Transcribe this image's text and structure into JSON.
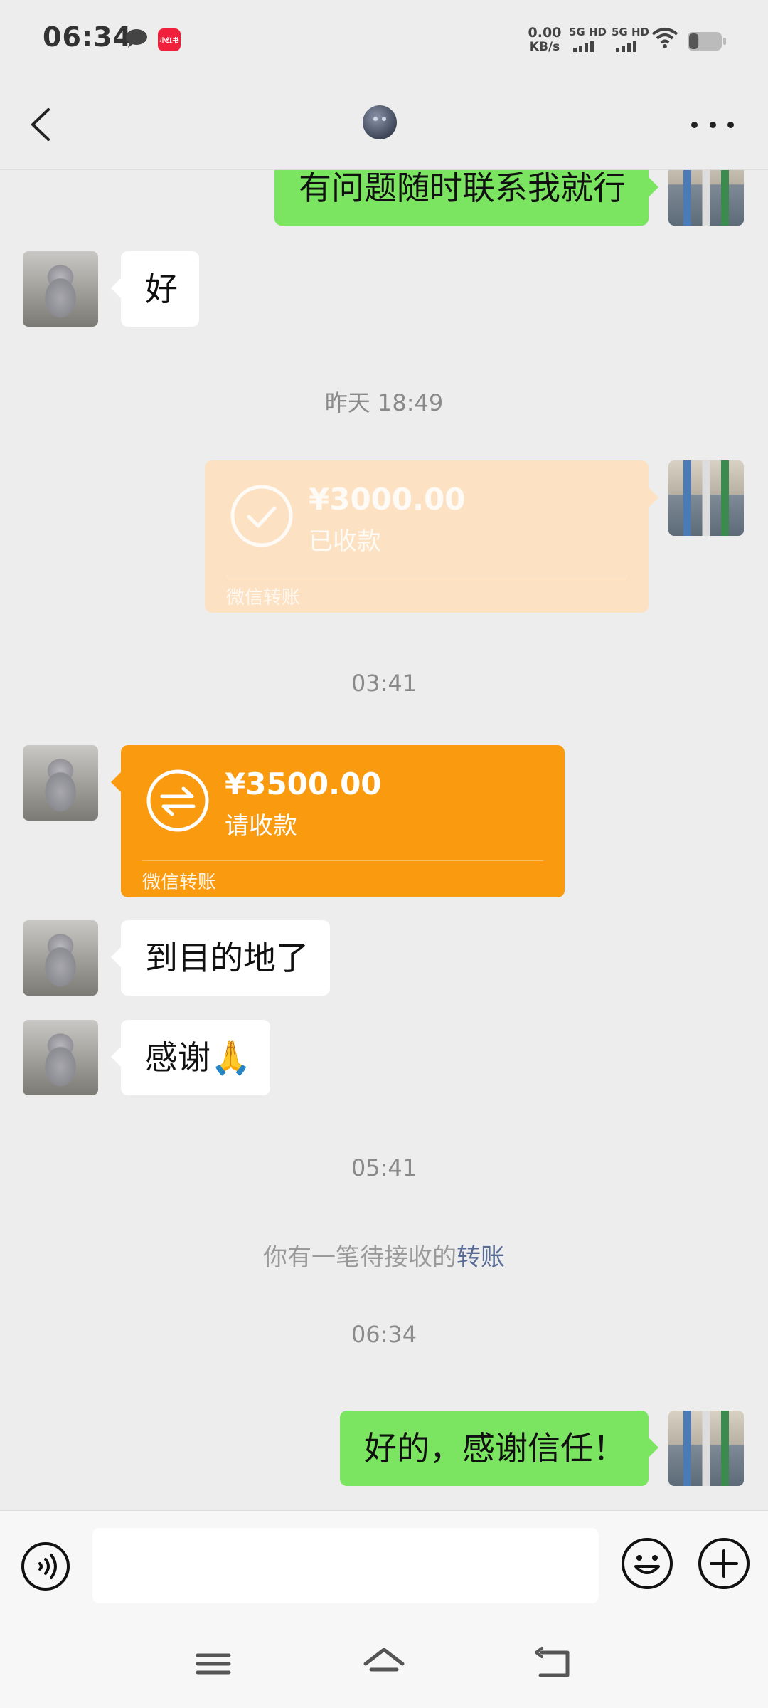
{
  "status_bar": {
    "time": "06:34",
    "net_speed_value": "0.00",
    "net_speed_unit": "KB/s",
    "signal_1_label": "5G HD",
    "signal_2_label": "5G HD",
    "app_badge": "小红书",
    "icons": [
      "chat-bubble-icon",
      "xiaohongshu-app-icon",
      "signal-icon",
      "wifi-icon",
      "battery-icon"
    ],
    "battery_level": 0.3
  },
  "header": {
    "icons": [
      "back-arrow-icon",
      "contact-avatar",
      "more-dots-icon"
    ]
  },
  "messages": {
    "m1_text": "有问题随时联系我就行",
    "m2_text": "好",
    "ts1": "昨天 18:49",
    "transfer1_amount": "¥3000.00",
    "transfer1_status": "已收款",
    "transfer1_label": "微信转账",
    "ts2": "03:41",
    "transfer2_amount": "¥3500.00",
    "transfer2_status": "请收款",
    "transfer2_label": "微信转账",
    "m3_text": "到目的地了",
    "m4_text": "感谢🙏",
    "ts3": "05:41",
    "system_prefix": "你有一笔待接收的",
    "system_link": "转账",
    "ts4": "06:34",
    "m5_text": "好的，感谢信任！"
  },
  "input_bar": {
    "message_value": "",
    "icons": [
      "voice-icon",
      "emoji-icon",
      "plus-icon"
    ]
  },
  "nav_bar": {
    "icons": [
      "menu-icon",
      "home-icon",
      "back-icon"
    ]
  },
  "colors": {
    "chat_background": "#ededed",
    "my_bubble": "#7be460",
    "their_bubble": "#ffffff",
    "transfer_received": "#fde1c3",
    "transfer_pending": "#fa9a0f",
    "link_blue": "#576b95"
  }
}
